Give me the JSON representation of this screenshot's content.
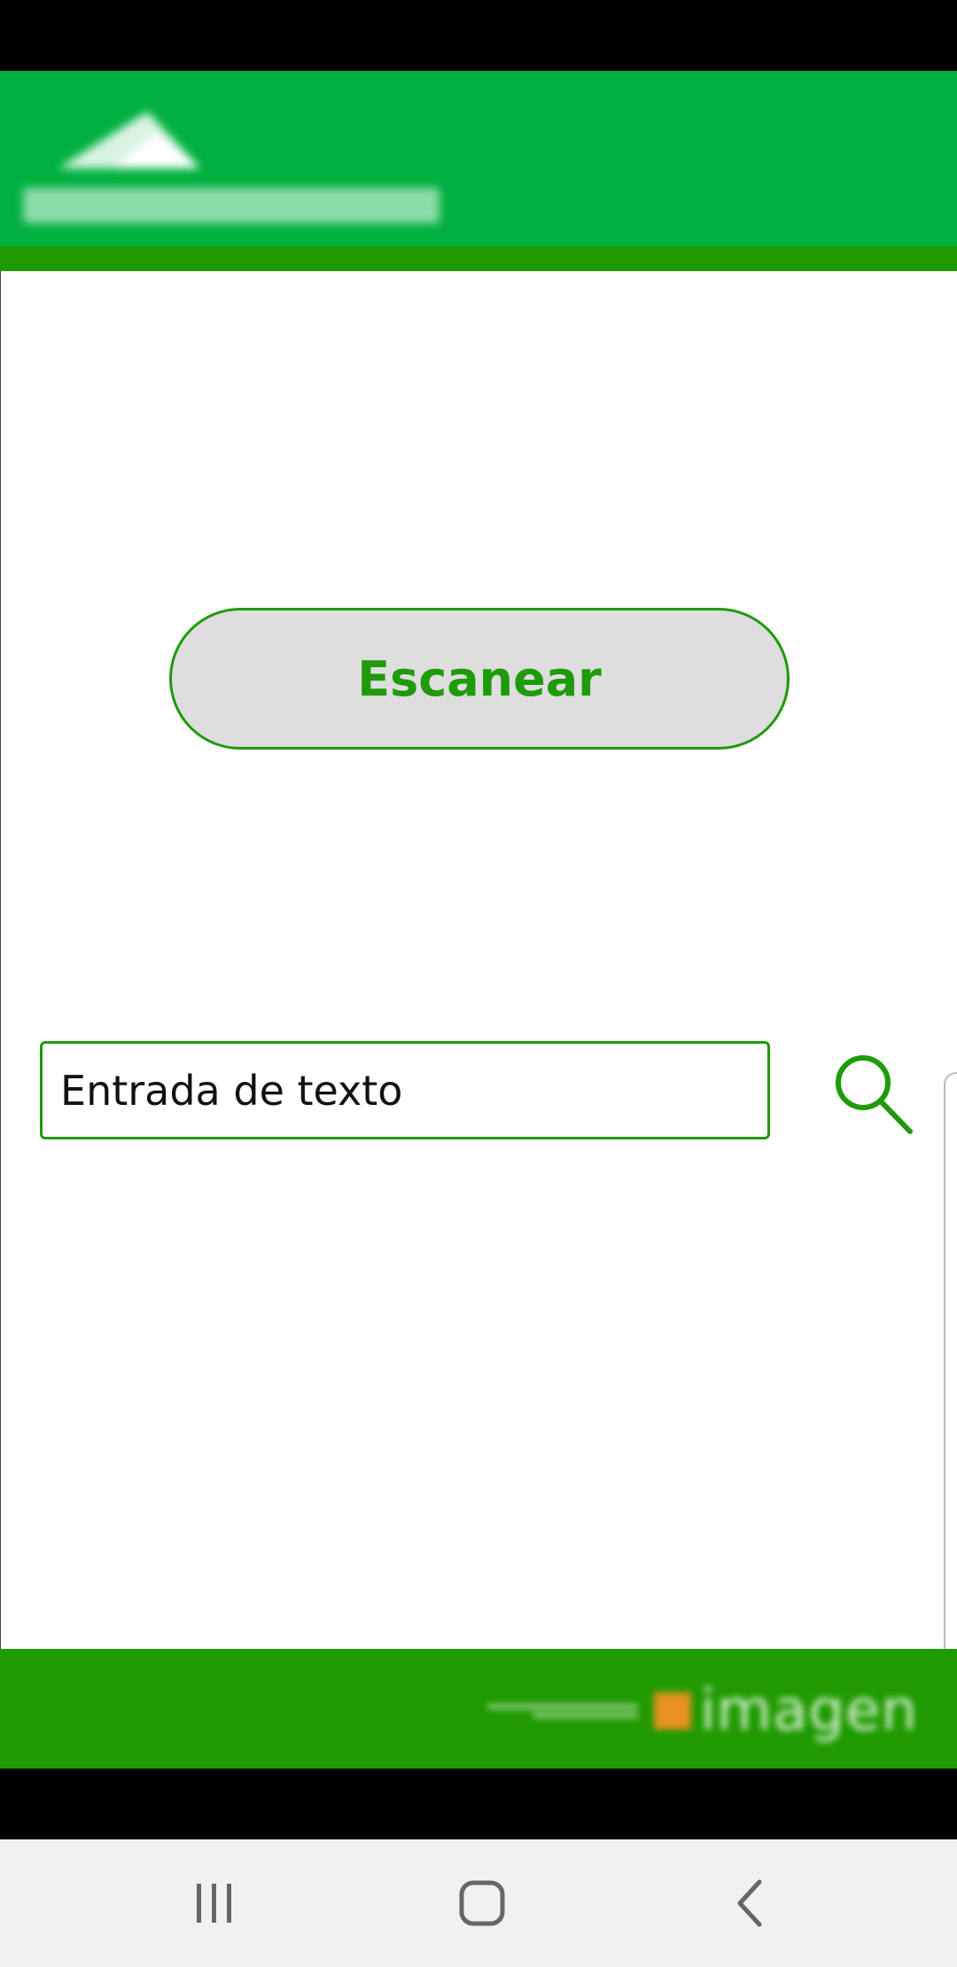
{
  "app": {
    "logo_text": "CEK L AMGASI",
    "accent": "#1f9a0a",
    "header_color": "#00b140"
  },
  "main": {
    "scan_label": "Escanear",
    "search_value": "Entrada de texto",
    "search_icon": "search-icon"
  },
  "footer": {
    "brand_text": "imagen"
  },
  "nav": {
    "recents_icon": "recent-apps-icon",
    "home_icon": "home-icon",
    "back_icon": "back-icon"
  }
}
